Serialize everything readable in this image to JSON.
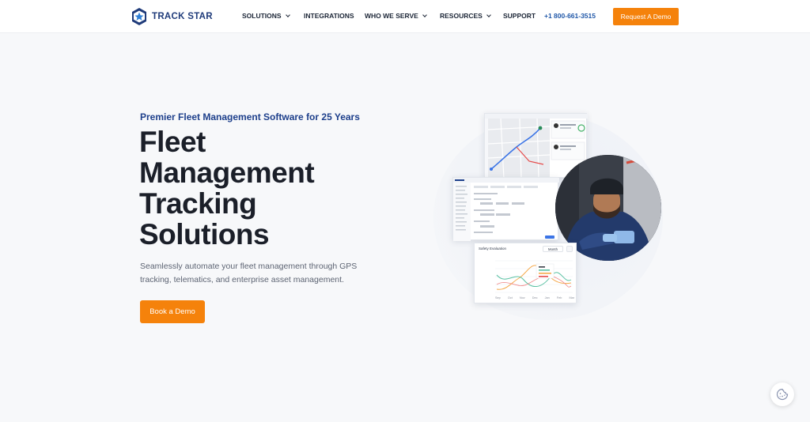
{
  "header": {
    "logo_text": "TRACK STAR",
    "nav": {
      "solutions": "SOLUTIONS",
      "integrations": "INTEGRATIONS",
      "who_we_serve": "WHO WE SERVE",
      "resources": "RESOURCES",
      "support": "SUPPORT"
    },
    "phone": "+1 800-661-3515",
    "demo_button": "Request A Demo"
  },
  "hero": {
    "eyebrow": "Premier Fleet Management Software for 25 Years",
    "headline": [
      "Fleet",
      "Management",
      "Tracking",
      "Solutions"
    ],
    "description": "Seamlessly automate your fleet management through GPS tracking, telematics, and enterprise asset management.",
    "cta": "Book a Demo"
  },
  "illustration": {
    "chart_title": "Safety Evaluation",
    "chart_filter": "Month",
    "months": [
      "Sep",
      "Oct",
      "Nov",
      "Dec",
      "Jan",
      "Feb",
      "Mar"
    ]
  },
  "colors": {
    "brand_navy": "#1d3f8b",
    "accent_orange": "#f5820b",
    "text_dark": "#1b1f29"
  }
}
